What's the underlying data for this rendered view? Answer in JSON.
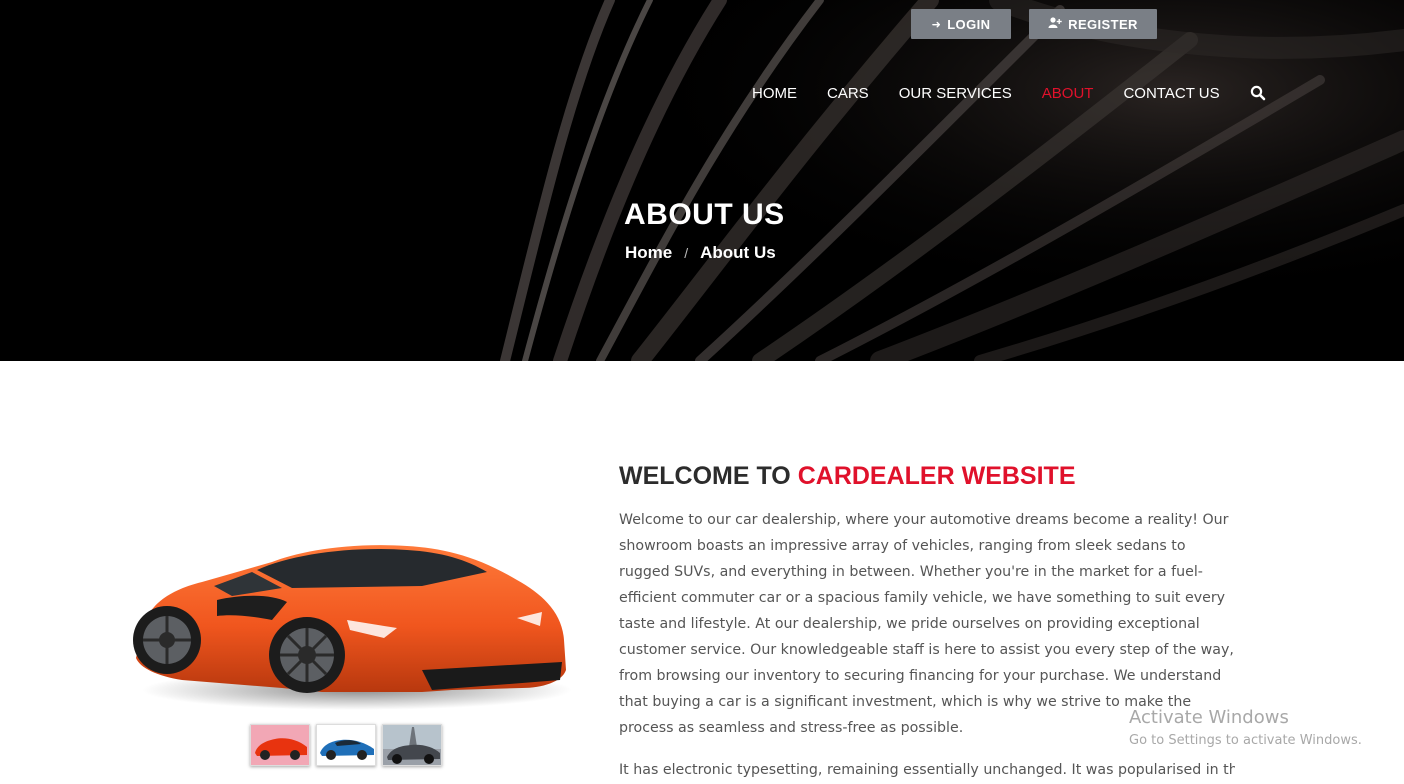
{
  "header": {
    "login_label": "LOGIN",
    "register_label": "REGISTER",
    "login_icon": "sign-in-icon",
    "register_icon": "user-plus-icon"
  },
  "nav": {
    "items": [
      {
        "label": "HOME",
        "active": false
      },
      {
        "label": "CARS",
        "active": false
      },
      {
        "label": "OUR SERVICES",
        "active": false
      },
      {
        "label": "ABOUT",
        "active": true
      },
      {
        "label": "CONTACT US",
        "active": false
      }
    ],
    "search_icon": "search-icon"
  },
  "hero": {
    "title": "ABOUT US",
    "breadcrumb": {
      "home": "Home",
      "separator": "/",
      "current": "About Us"
    }
  },
  "about": {
    "welcome_prefix": "WELCOME TO",
    "welcome_accent": "CARDEALER WEBSITE",
    "paragraph": "Welcome to our car dealership, where your automotive dreams become a reality! Our showroom boasts an impressive array of vehicles, ranging from sleek sedans to rugged SUVs, and everything in between. Whether you're in the market for a fuel-efficient commuter car or a spacious family vehicle, we have something to suit every taste and lifestyle. At our dealership, we pride ourselves on providing exceptional customer service. Our knowledgeable staff is here to assist you every step of the way, from browsing our inventory to securing financing for your purchase. We understand that buying a car is a significant investment, which is why we strive to make the process as seamless and stress-free as possible.",
    "paragraph2": "It has electronic typesetting, remaining essentially unchanged. It was popularised in the"
  },
  "gallery": {
    "thumbnails": [
      "orange-sports-car",
      "blue-sedan",
      "grey-car"
    ]
  },
  "watermark": {
    "title": "Activate Windows",
    "subtitle": "Go to Settings to activate Windows."
  },
  "colors": {
    "accent": "#e0112b",
    "hero_bg": "#000000",
    "button_bg": "#7a7f86",
    "text": "#555555",
    "heading": "#2c2c2c"
  }
}
